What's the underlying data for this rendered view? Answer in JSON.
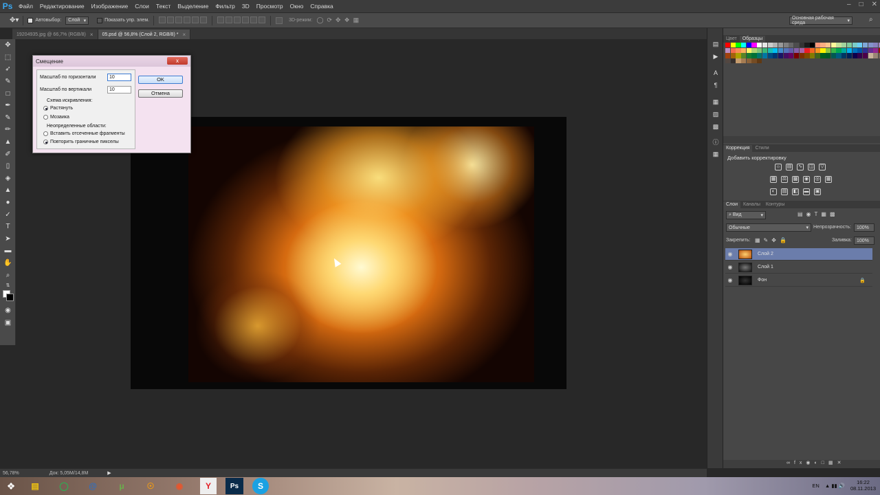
{
  "app": {
    "logo": "Ps"
  },
  "menu": [
    "Файл",
    "Редактирование",
    "Изображение",
    "Слои",
    "Текст",
    "Выделение",
    "Фильтр",
    "3D",
    "Просмотр",
    "Окно",
    "Справка"
  ],
  "options": {
    "autoselect_label": "Автовыбор:",
    "autoselect_value": "Слой",
    "show_controls_label": "Показать упр. элем.",
    "mode3d_label": "3D-режим:",
    "workspace_select": "Основная рабочая среда"
  },
  "tabs": [
    {
      "label": "19204935.jpg @ 66,7% (RGB/8)",
      "active": false
    },
    {
      "label": "05.psd @ 56,8% (Слой 2, RGB/8) *",
      "active": true
    }
  ],
  "dialog": {
    "title": "Смещение",
    "close_label": "x",
    "h_scale_label": "Масштаб по горизонтали",
    "h_scale_value": "10",
    "v_scale_label": "Масштаб по вертикали",
    "v_scale_value": "10",
    "distort_group": "Схема искривления:",
    "distort_opt1": "Растянуть",
    "distort_opt2": "Мозаика",
    "undef_group": "Неопределенные области:",
    "undef_opt1": "Вставить отсеченные фрагменты",
    "undef_opt2": "Повторить граничные пикселы",
    "ok_label": "OK",
    "cancel_label": "Отмена"
  },
  "panels": {
    "color_tabs": [
      "Цвет",
      "Образцы"
    ],
    "adj_tabs": [
      "Коррекция",
      "Стили"
    ],
    "adj_add_label": "Добавить корректировку",
    "layers_tabs": [
      "Слои",
      "Каналы",
      "Контуры"
    ],
    "kind_select": "Вид",
    "blend_mode": "Обычные",
    "opacity_label": "Непрозрачность:",
    "opacity_value": "100%",
    "lock_label": "Закрепить:",
    "fill_label": "Заливка:",
    "fill_value": "100%",
    "layers": [
      {
        "name": "Слой 2",
        "selected": true
      },
      {
        "name": "Слой 1",
        "selected": false
      },
      {
        "name": "Фон",
        "selected": false
      }
    ]
  },
  "status": {
    "zoom": "56,78%",
    "doc": "Док: 5,05M/14,8M"
  },
  "taskbar": {
    "lang": "EN",
    "time": "16:22",
    "date": "08.11.2013"
  },
  "colors": {
    "accent": "#3aa7f0",
    "selected_layer": "#6b7dab"
  }
}
